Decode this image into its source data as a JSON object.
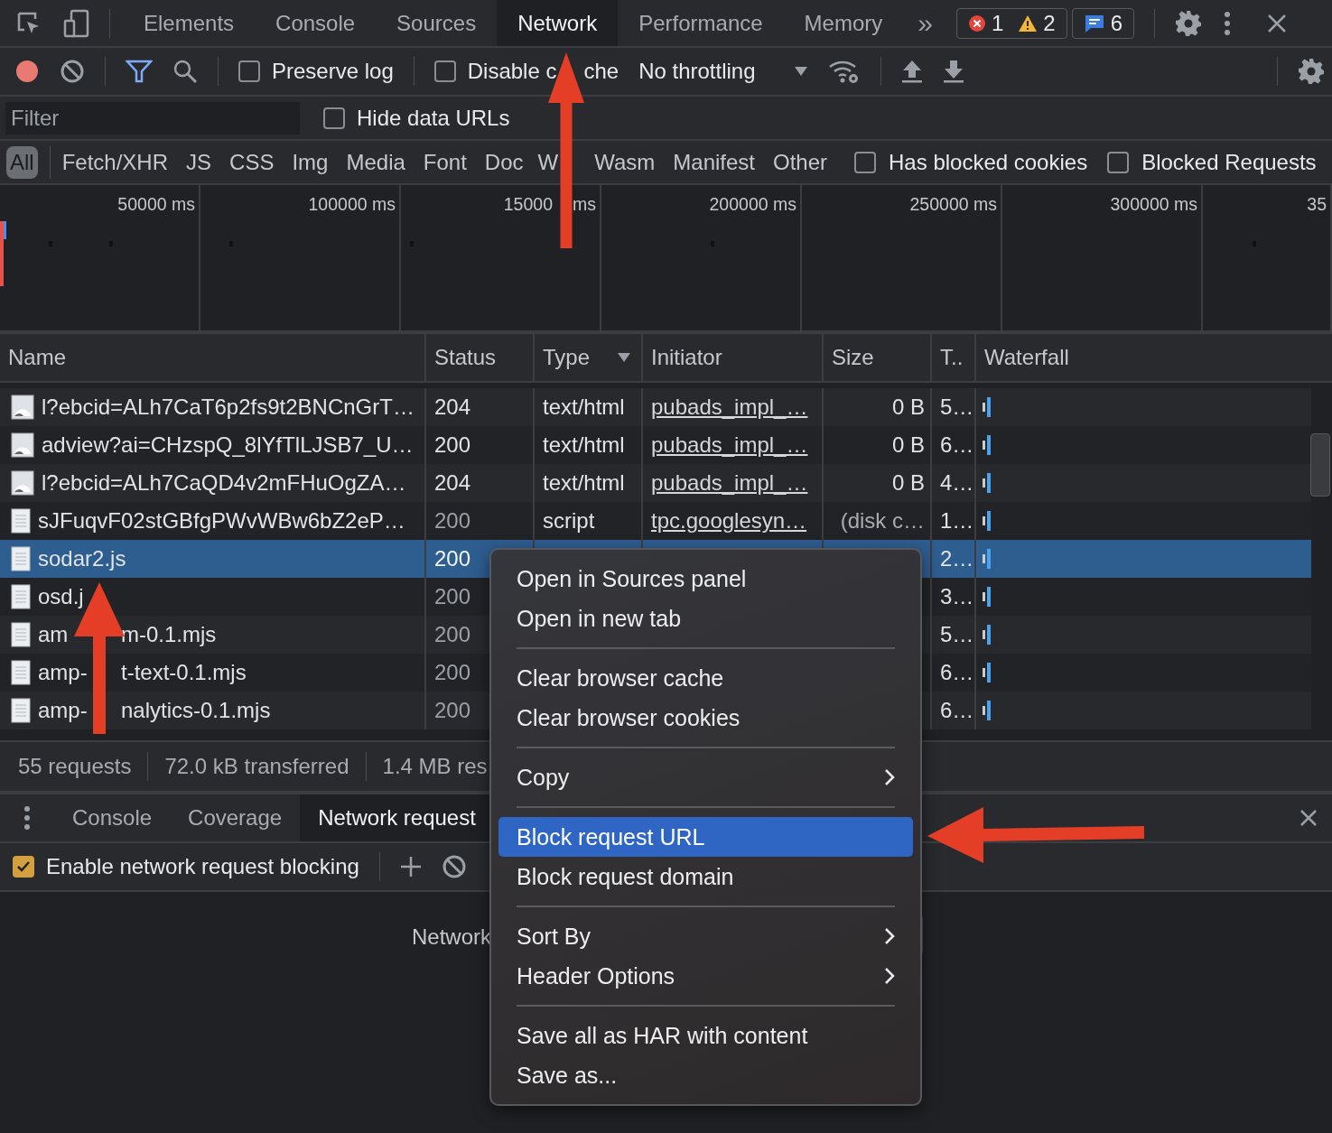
{
  "panel_tabs": [
    {
      "label": "Elements",
      "selected": false
    },
    {
      "label": "Console",
      "selected": false
    },
    {
      "label": "Sources",
      "selected": false
    },
    {
      "label": "Network",
      "selected": true
    },
    {
      "label": "Performance",
      "selected": false
    },
    {
      "label": "Memory",
      "selected": false
    }
  ],
  "more_tabs": "»",
  "issues": {
    "errors": "1",
    "warnings": "2",
    "messages": "6"
  },
  "toolbar": {
    "preserve_log": {
      "label": "Preserve log",
      "checked": false
    },
    "disable_cache": {
      "label": "Disable c",
      "label_tail": "che",
      "checked": false
    },
    "throttling": "No throttling"
  },
  "filter": {
    "placeholder": "Filter",
    "hide_data_urls": {
      "label": "Hide data URLs",
      "checked": false
    }
  },
  "type_filters": [
    {
      "label": "All",
      "selected": true
    },
    {
      "label": "Fetch/XHR",
      "selected": false
    },
    {
      "label": "JS",
      "selected": false
    },
    {
      "label": "CSS",
      "selected": false
    },
    {
      "label": "Img",
      "selected": false
    },
    {
      "label": "Media",
      "selected": false
    },
    {
      "label": "Font",
      "selected": false
    },
    {
      "label": "Doc",
      "selected": false
    },
    {
      "label": "W",
      "selected": false
    },
    {
      "label": "Wasm",
      "selected": false
    },
    {
      "label": "Manifest",
      "selected": false
    },
    {
      "label": "Other",
      "selected": false
    }
  ],
  "extra_filters": [
    {
      "label": "Has blocked cookies",
      "checked": false
    },
    {
      "label": "Blocked Requests",
      "checked": false
    }
  ],
  "timeline": {
    "ticks": [
      {
        "label": "50000 ms"
      },
      {
        "label": "100000 ms"
      },
      {
        "label": "15000",
        "tail": "ms"
      },
      {
        "label": "200000 ms"
      },
      {
        "label": "250000 ms"
      },
      {
        "label": "300000 ms"
      },
      {
        "label": "35"
      }
    ]
  },
  "table": {
    "columns": [
      "Name",
      "Status",
      "Type",
      "Initiator",
      "Size",
      "T..",
      "Waterfall"
    ],
    "rows": [
      {
        "kind": "image",
        "name": "l?ebcid=ALh7CaT6p2fs9t2BNCnGrT…",
        "status": "204",
        "type": "text/html",
        "initiator": "pubads_impl_…",
        "size": "0 B",
        "time": "5…",
        "cached": false,
        "selected": false
      },
      {
        "kind": "image",
        "name": "adview?ai=CHzspQ_8lYfTlLJSB7_U…",
        "status": "200",
        "type": "text/html",
        "initiator": "pubads_impl_…",
        "size": "0 B",
        "time": "6…",
        "cached": false,
        "selected": false
      },
      {
        "kind": "image",
        "name": "l?ebcid=ALh7CaQD4v2mFHuOgZA…",
        "status": "204",
        "type": "text/html",
        "initiator": "pubads_impl_…",
        "size": "0 B",
        "time": "4…",
        "cached": false,
        "selected": false
      },
      {
        "kind": "document",
        "name": "sJFuqvF02stGBfgPWvWBw6bZ2eP…",
        "status": "200",
        "type": "script",
        "initiator": "tpc.googlesyn…",
        "size": "(disk c…",
        "time": "1…",
        "cached": true,
        "selected": false
      },
      {
        "kind": "document",
        "name": "sodar2.js",
        "status": "200",
        "time": "2…",
        "cached": true,
        "selected": true
      },
      {
        "kind": "document",
        "name": "osd.j",
        "status": "200",
        "time": "3…",
        "cached": true,
        "selected": false
      },
      {
        "kind": "document",
        "name": "am",
        "name_tail": "m-0.1.mjs",
        "status": "200",
        "time": "5…",
        "cached": true,
        "selected": false
      },
      {
        "kind": "document",
        "name": "amp-",
        "name_tail": "t-text-0.1.mjs",
        "status": "200",
        "time": "6…",
        "cached": true,
        "selected": false
      },
      {
        "kind": "document",
        "name": "amp-",
        "name_tail": "nalytics-0.1.mjs",
        "status": "200",
        "time": "6…",
        "cached": true,
        "selected": false
      }
    ]
  },
  "summary": [
    "55 requests",
    "72.0 kB transferred",
    "1.4 MB res"
  ],
  "drawer": {
    "tabs": [
      {
        "label": "Console",
        "selected": false
      },
      {
        "label": "Coverage",
        "selected": false
      },
      {
        "label": "Network request",
        "selected": true
      }
    ],
    "enable_blocking": {
      "label": "Enable network request blocking",
      "checked": true
    },
    "body_text": "Network"
  },
  "context_menu": {
    "sections": [
      [
        {
          "label": "Open in Sources panel",
          "submenu": false,
          "selected": false
        },
        {
          "label": "Open in new tab",
          "submenu": false,
          "selected": false
        }
      ],
      [
        {
          "label": "Clear browser cache",
          "submenu": false,
          "selected": false
        },
        {
          "label": "Clear browser cookies",
          "submenu": false,
          "selected": false
        }
      ],
      [
        {
          "label": "Copy",
          "submenu": true,
          "selected": false
        }
      ],
      [
        {
          "label": "Block request URL",
          "submenu": false,
          "selected": true
        },
        {
          "label": "Block request domain",
          "submenu": false,
          "selected": false
        }
      ],
      [
        {
          "label": "Sort By",
          "submenu": true,
          "selected": false
        },
        {
          "label": "Header Options",
          "submenu": true,
          "selected": false
        }
      ],
      [
        {
          "label": "Save all as HAR with content",
          "submenu": false,
          "selected": false
        },
        {
          "label": "Save as...",
          "submenu": false,
          "selected": false
        }
      ]
    ]
  }
}
